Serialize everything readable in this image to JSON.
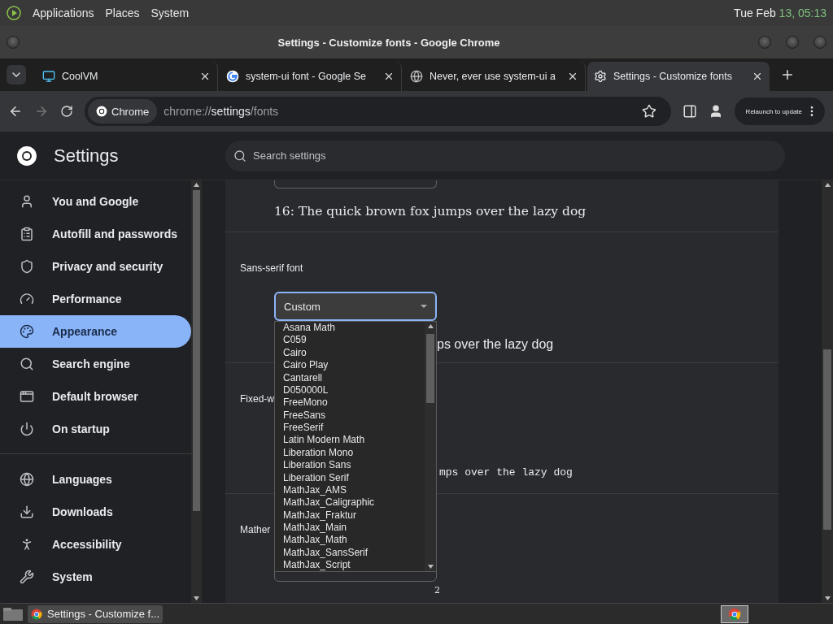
{
  "top_panel": {
    "menus": [
      "Applications",
      "Places",
      "System"
    ],
    "clock": {
      "date": "Tue Feb",
      "time": "13, 05:13"
    }
  },
  "window": {
    "title": "Settings - Customize fonts - Google Chrome"
  },
  "tabs": [
    {
      "title": "CoolVM",
      "kind": "monitor",
      "selected": false
    },
    {
      "title": "system-ui font - Google Se",
      "kind": "google",
      "selected": false
    },
    {
      "title": "Never, ever use system-ui a",
      "kind": "globe",
      "selected": false
    },
    {
      "title": "Settings - Customize fonts",
      "kind": "gear",
      "selected": true
    }
  ],
  "toolbar": {
    "site_chip": "Chrome",
    "url": {
      "scheme": "chrome://",
      "host": "settings",
      "path": "/fonts"
    },
    "update_button": "Relaunch to update"
  },
  "settings": {
    "title": "Settings",
    "search": {
      "placeholder": "Search settings"
    }
  },
  "sidebar": {
    "groups": [
      {
        "items": [
          {
            "label": "You and Google",
            "kind": "person",
            "selected": false
          },
          {
            "label": "Autofill and passwords",
            "kind": "clipboard",
            "selected": false
          },
          {
            "label": "Privacy and security",
            "kind": "shield",
            "selected": false
          },
          {
            "label": "Performance",
            "kind": "gauge",
            "selected": false
          },
          {
            "label": "Appearance",
            "kind": "palette",
            "selected": true
          },
          {
            "label": "Search engine",
            "kind": "search",
            "selected": false
          },
          {
            "label": "Default browser",
            "kind": "browser",
            "selected": false
          },
          {
            "label": "On startup",
            "kind": "power",
            "selected": false
          }
        ]
      },
      {
        "items": [
          {
            "label": "Languages",
            "kind": "globe",
            "selected": false
          },
          {
            "label": "Downloads",
            "kind": "download",
            "selected": false
          },
          {
            "label": "Accessibility",
            "kind": "accessibility",
            "selected": false
          },
          {
            "label": "System",
            "kind": "wrench",
            "selected": false
          }
        ]
      }
    ]
  },
  "content": {
    "serif_sample": "16: The quick brown fox jumps over the lazy dog",
    "sans_serif": {
      "label": "Sans-serif font",
      "select": {
        "value": "Custom",
        "expanded": true
      },
      "sample": "ps over the lazy dog",
      "options": [
        "Asana Math",
        "C059",
        "Cairo",
        "Cairo Play",
        "Cantarell",
        "D050000L",
        "FreeMono",
        "FreeSans",
        "FreeSerif",
        "Latin Modern Math",
        "Liberation Mono",
        "Liberation Sans",
        "Liberation Serif",
        "MathJax_AMS",
        "MathJax_Caligraphic",
        "MathJax_Fraktur",
        "MathJax_Main",
        "MathJax_Math",
        "MathJax_SansSerif",
        "MathJax_Script"
      ]
    },
    "fixed_width": {
      "label": "Fixed-w",
      "sample": "mps over the lazy dog"
    },
    "math": {
      "label": "Mather",
      "sample": "2"
    }
  },
  "taskbar": {
    "task": "Settings - Customize f..."
  }
}
